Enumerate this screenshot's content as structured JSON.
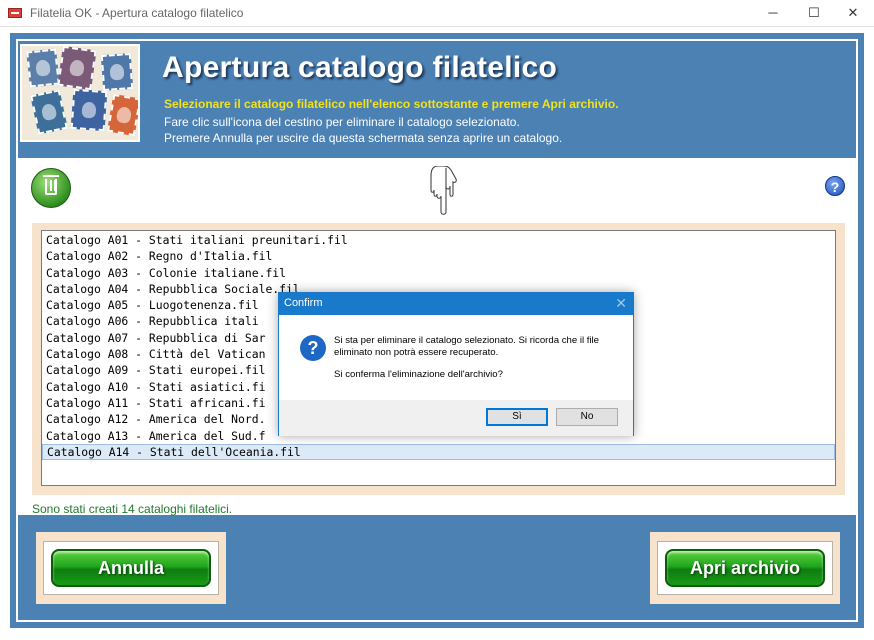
{
  "window": {
    "title": "Filatelia OK - Apertura catalogo filatelico",
    "minimize": "─",
    "maximize": "☐",
    "close": "✕"
  },
  "header": {
    "title": "Apertura catalogo filatelico",
    "line1": "Selezionare il catalogo filatelico nell'elenco sottostante e premere Apri archivio.",
    "line2": "Fare clic sull'icona del cestino per eliminare il catalogo selezionato.",
    "line3": "Premere Annulla per uscire da questa schermata senza aprire un catalogo."
  },
  "icons": {
    "help": "?"
  },
  "catalogs": [
    "Catalogo A01 - Stati italiani preunitari.fil",
    "Catalogo A02 - Regno d'Italia.fil",
    "Catalogo A03 - Colonie italiane.fil",
    "Catalogo A04 - Repubblica Sociale.fil",
    "Catalogo A05 - Luogotenenza.fil",
    "Catalogo A06 - Repubblica itali",
    "Catalogo A07 - Repubblica di Sar",
    "Catalogo A08 - Città del Vatican",
    "Catalogo A09 - Stati europei.fil",
    "Catalogo A10 - Stati asiatici.fi",
    "Catalogo A11 - Stati africani.fi",
    "Catalogo A12 - America del Nord.",
    "Catalogo A13 - America del Sud.f",
    "Catalogo A14 - Stati dell'Oceania.fil"
  ],
  "selected_index": 13,
  "status": "Sono stati creati 14 cataloghi filatelici.",
  "buttons": {
    "cancel": "Annulla",
    "open": "Apri archivio"
  },
  "dialog": {
    "title": "Confirm",
    "close": "✕",
    "icon": "?",
    "message1": "Si sta per eliminare il catalogo selezionato. Si ricorda che il file eliminato non potrà essere recuperato.",
    "message2": "Si conferma l'eliminazione dell'archivio?",
    "yes": "Sì",
    "no": "No"
  }
}
